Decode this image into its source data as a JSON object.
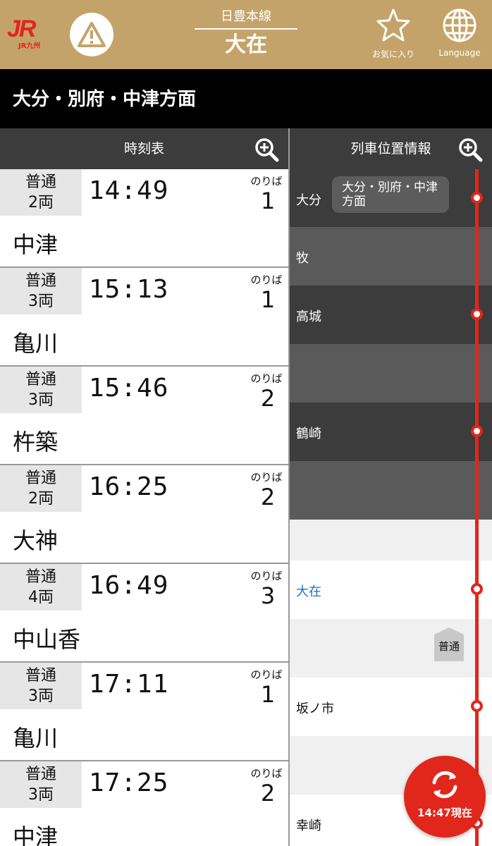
{
  "header": {
    "logo_text": "JR",
    "logo_sub": "JR九州",
    "line_name": "日豊本線",
    "station_name": "大在",
    "favorite_label": "お気に入り",
    "language_label": "Language"
  },
  "direction": "大分・別府・中津方面",
  "timetable": {
    "title": "時刻表",
    "platform_label": "のりば",
    "trains": [
      {
        "type": "普通",
        "cars": "2両",
        "time": "14:49",
        "platform": "1",
        "destination": "中津"
      },
      {
        "type": "普通",
        "cars": "3両",
        "time": "15:13",
        "platform": "1",
        "destination": "亀川"
      },
      {
        "type": "普通",
        "cars": "3両",
        "time": "15:46",
        "platform": "2",
        "destination": "杵築"
      },
      {
        "type": "普通",
        "cars": "2両",
        "time": "16:25",
        "platform": "2",
        "destination": "大神"
      },
      {
        "type": "普通",
        "cars": "4両",
        "time": "16:49",
        "platform": "3",
        "destination": "中山香"
      },
      {
        "type": "普通",
        "cars": "3両",
        "time": "17:11",
        "platform": "1",
        "destination": "亀川"
      },
      {
        "type": "普通",
        "cars": "3両",
        "time": "17:25",
        "platform": "2",
        "destination": "中津"
      }
    ]
  },
  "position": {
    "title": "列車位置情報",
    "direction_pill": "大分・別府・中津方面",
    "stations": {
      "oita": "大分",
      "maki": "牧",
      "takajo": "高城",
      "tsurusaki": "鶴崎",
      "ozai": "大在",
      "sakanoichi": "坂ノ市",
      "kozaki": "幸崎"
    },
    "train_tag": "普通"
  },
  "refresh": {
    "label": "14:47現在"
  },
  "colors": {
    "header_bg": "#c4a36a",
    "brand_red": "#e1261c",
    "current_station": "#1a73c9"
  }
}
